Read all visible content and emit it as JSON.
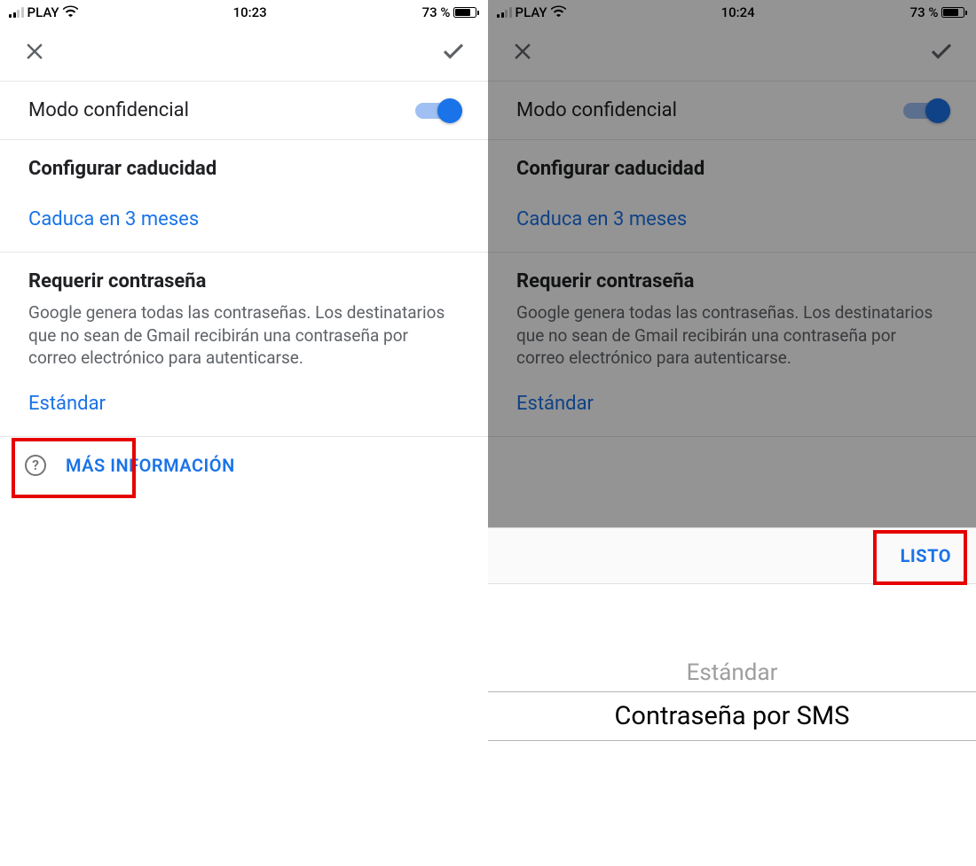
{
  "left": {
    "status": {
      "carrier": "PLAY",
      "time": "10:23",
      "battery_pct": "73 %"
    },
    "confidential": {
      "label": "Modo confidencial"
    },
    "expiry": {
      "title": "Configurar caducidad",
      "value": "Caduca en 3 meses"
    },
    "password": {
      "title": "Requerir contraseña",
      "body": "Google genera todas las contraseñas. Los destinatarios que no sean de Gmail recibirán una contraseña por correo electrónico para autenticarse.",
      "value": "Estándar"
    },
    "more_info": "MÁS INFORMACIÓN"
  },
  "right": {
    "status": {
      "carrier": "PLAY",
      "time": "10:24",
      "battery_pct": "73 %"
    },
    "confidential": {
      "label": "Modo confidencial"
    },
    "expiry": {
      "title": "Configurar caducidad",
      "value": "Caduca en 3 meses"
    },
    "password": {
      "title": "Requerir contraseña",
      "body": "Google genera todas las contraseñas. Los destinatarios que no sean de Gmail recibirán una contraseña por correo electrónico para autenticarse.",
      "value": "Estándar"
    },
    "toolbar": {
      "done": "LISTO"
    },
    "picker": {
      "option_faded": "Estándar",
      "option_selected": "Contraseña por SMS"
    }
  }
}
